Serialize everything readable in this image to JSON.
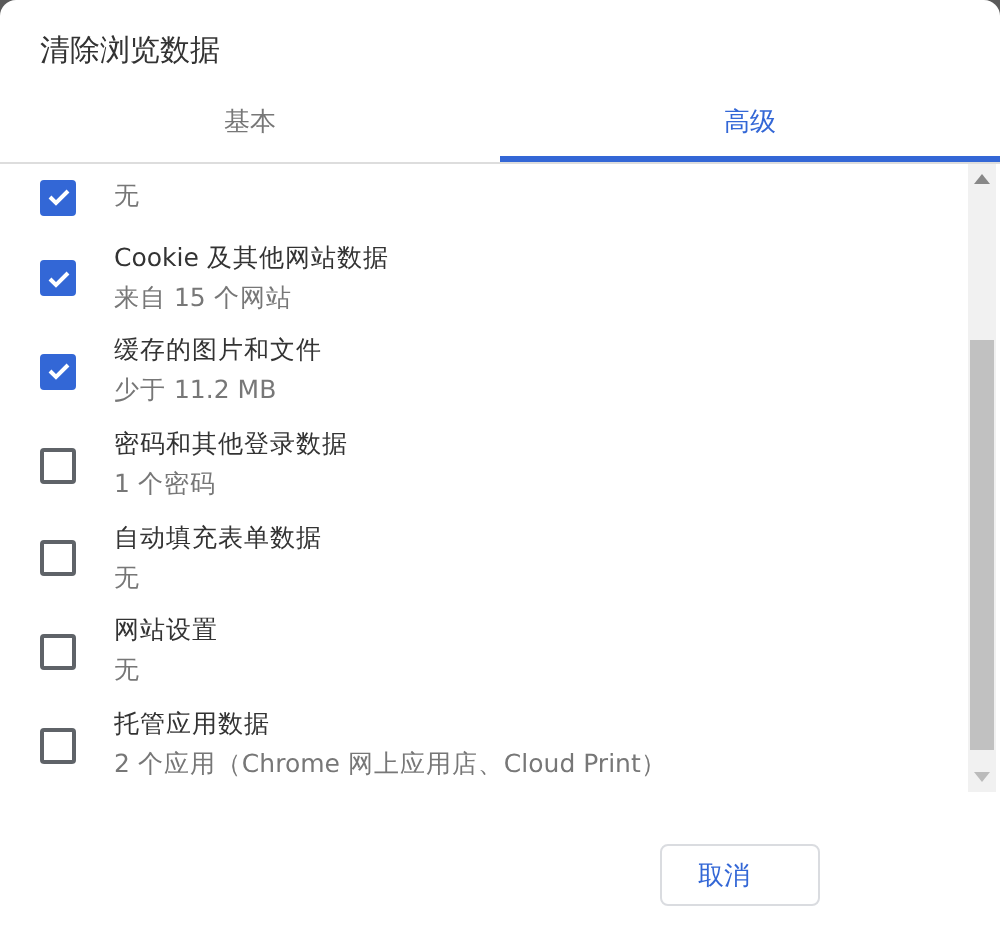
{
  "dialog": {
    "title": "清除浏览数据"
  },
  "tabs": [
    {
      "label": "基本",
      "selected": false
    },
    {
      "label": "高级",
      "selected": true
    }
  ],
  "items": [
    {
      "detail": "无",
      "checked": true
    },
    {
      "label": "Cookie 及其他网站数据",
      "detail": "来自 15 个网站",
      "checked": true
    },
    {
      "label": "缓存的图片和文件",
      "detail": "少于 11.2 MB",
      "checked": true
    },
    {
      "label": "密码和其他登录数据",
      "detail": "1 个密码",
      "checked": false
    },
    {
      "label": "自动填充表单数据",
      "detail": "无",
      "checked": false
    },
    {
      "label": "网站设置",
      "detail": "无",
      "checked": false
    },
    {
      "label": "托管应用数据",
      "detail": "2 个应用（Chrome 网上应用店、Cloud Print）",
      "checked": false
    }
  ],
  "buttons": [
    {
      "label": "取消"
    }
  ]
}
